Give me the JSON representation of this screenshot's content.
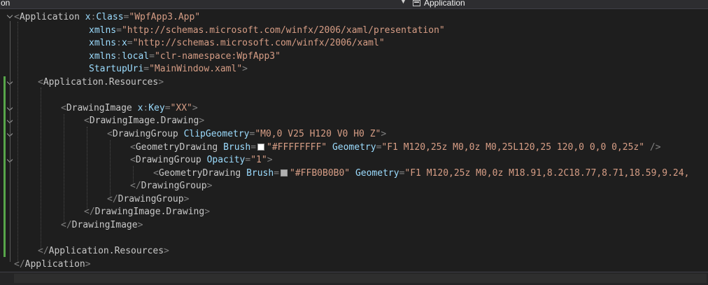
{
  "topbar": {
    "left_text": "on",
    "right_text": "Application"
  },
  "code": {
    "line1": {
      "tag": "Application",
      "a1": "x",
      "a2": "Class",
      "v": "\"WpfApp3.App\""
    },
    "line2": {
      "a": "xmlns",
      "v": "\"http://schemas.microsoft.com/winfx/2006/xaml/presentation\""
    },
    "line3": {
      "a1": "xmlns",
      "a2": "x",
      "v": "\"http://schemas.microsoft.com/winfx/2006/xaml\""
    },
    "line4": {
      "a1": "xmlns",
      "a2": "local",
      "v": "\"clr-namespace:WpfApp3\""
    },
    "line5": {
      "a": "StartupUri",
      "v": "\"MainWindow.xaml\""
    },
    "line6": {
      "tag": "Application.Resources"
    },
    "line8": {
      "tag": "DrawingImage",
      "a1": "x",
      "a2": "Key",
      "v": "\"XX\""
    },
    "line9": {
      "tag": "DrawingImage.Drawing"
    },
    "line10": {
      "tag": "DrawingGroup",
      "a": "ClipGeometry",
      "v": "\"M0,0 V25 H120 V0 H0 Z\""
    },
    "line11": {
      "tag": "GeometryDrawing",
      "a1": "Brush",
      "v1": "\"#FFFFFFFF\"",
      "a2": "Geometry",
      "v2": "\"F1 M120,25z M0,0z M0,25L120,25 120,0 0,0 0,25z\""
    },
    "line12": {
      "tag": "DrawingGroup",
      "a": "Opacity",
      "v": "\"1\""
    },
    "line13": {
      "tag": "GeometryDrawing",
      "a1": "Brush",
      "v1": "\"#FFB0B0B0\"",
      "a2": "Geometry",
      "v2": "\"F1 M120,25z M0,0z M18.91,8.2C18.77,8.71,18.59,9.24,"
    },
    "line14": {
      "tag": "DrawingGroup"
    },
    "line15": {
      "tag": "DrawingGroup"
    },
    "line16": {
      "tag": "DrawingImage.Drawing"
    },
    "line17": {
      "tag": "DrawingImage"
    },
    "line19": {
      "tag": "Application.Resources"
    },
    "line20": {
      "tag": "Application"
    }
  },
  "colors": {
    "background": "#1e1e1e",
    "element": "#c8c8c8",
    "attribute": "#9cdcfe",
    "value": "#d69d85",
    "punctuation": "#808080",
    "change_bar": "#57a64a",
    "swatch_white": "#FFFFFF",
    "swatch_gray": "#B0B0B0"
  }
}
